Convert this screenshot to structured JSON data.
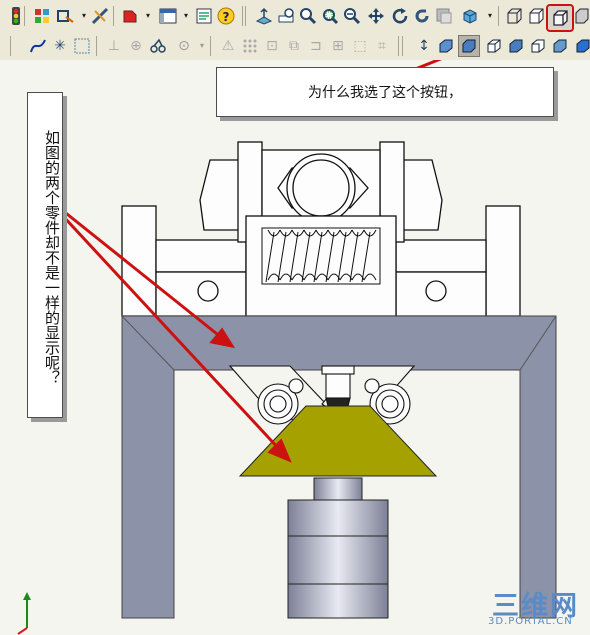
{
  "toolbar_top": {
    "icons": [
      "traffic-light-icon",
      "palette-icon",
      "scale-icon",
      "measure-icon",
      "color-icon",
      "display-icon",
      "properties-icon",
      "help-icon",
      "normal-to-icon",
      "zoom-fit-icon",
      "zoom-in-icon",
      "zoom-area-icon",
      "zoom-out-icon",
      "pan-icon",
      "rotate-icon",
      "refresh-icon",
      "section-icon",
      "view-orientation-icon",
      "wireframe-icon",
      "hidden-lines-visible-icon",
      "hidden-lines-removed-icon"
    ]
  },
  "toolbar_second": {
    "icons": [
      "sketch-icon",
      "spline-icon",
      "point-icon",
      "grid-icon",
      "dimension-icon",
      "relation-icon",
      "mirror-icon",
      "circle-icon",
      "warning-icon",
      "pattern-icon",
      "offset-icon",
      "trim-icon",
      "extend-icon",
      "convert-icon",
      "move-icon",
      "shaded-icon",
      "shaded-edges-icon",
      "perspective-icon",
      "shadow-icon",
      "rendering-icon"
    ]
  },
  "callout": {
    "text": "为什么我选了这个按钮，"
  },
  "side_note": {
    "text": "如图的两个零件却不是一样的显示呢？"
  },
  "watermark": {
    "big": "三维网",
    "small": "3D.PORTAL.CN"
  },
  "colors": {
    "frame": "#8c92a8",
    "cone": "#a4a100",
    "arrow": "#cc1111",
    "highlight": "#cc1111",
    "toolbar": "#ece9d8"
  }
}
